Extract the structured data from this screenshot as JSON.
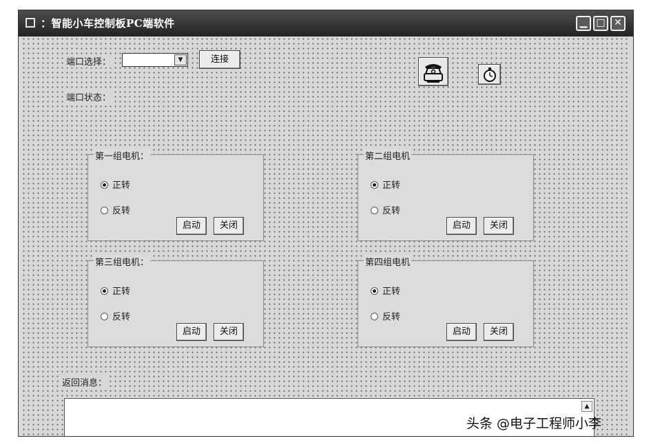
{
  "window": {
    "title": "：智能小车控制板PC端软件",
    "buttons": [
      "minimize",
      "maximize",
      "close"
    ]
  },
  "port": {
    "select_label": "端口选择：",
    "selected_value": "",
    "connect_label": "连接",
    "status_label": "端口状态："
  },
  "toolbar_icons": [
    "phone-icon",
    "stopwatch-icon"
  ],
  "groups": [
    {
      "title": "第一组电机：",
      "forward": "正转",
      "reverse": "反转",
      "forward_checked": true,
      "start": "启动",
      "close": "关闭"
    },
    {
      "title": "第二组电机",
      "forward": "正转",
      "reverse": "反转",
      "forward_checked": true,
      "start": "启动",
      "close": "关闭"
    },
    {
      "title": "第三组电机：",
      "forward": "正转",
      "reverse": "反转",
      "forward_checked": true,
      "start": "启动",
      "close": "关闭"
    },
    {
      "title": "第四组电机",
      "forward": "正转",
      "reverse": "反转",
      "forward_checked": true,
      "start": "启动",
      "close": "关闭"
    }
  ],
  "messages": {
    "label": "返回消息：",
    "value": ""
  },
  "watermark": "头条 @电子工程师小李"
}
